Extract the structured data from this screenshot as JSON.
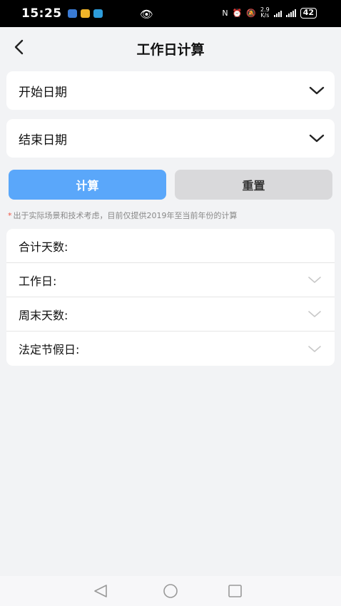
{
  "status_bar": {
    "time": "15:25",
    "network_speed": "2.9",
    "network_unit": "K/s",
    "battery": "42"
  },
  "header": {
    "title": "工作日计算"
  },
  "form": {
    "start_date_label": "开始日期",
    "end_date_label": "结束日期"
  },
  "actions": {
    "calculate_label": "计算",
    "reset_label": "重置"
  },
  "note": {
    "marker": "*",
    "text": "出于实际场景和技术考虑，目前仅提供2019年至当前年份的计算"
  },
  "results": {
    "total_days_label": "合计天数:",
    "workdays_label": "工作日:",
    "weekend_days_label": "周末天数:",
    "holidays_label": "法定节假日:"
  },
  "colors": {
    "accent": "#5aa7fa",
    "reset_bg": "#d9d9db",
    "background": "#f2f3f5"
  }
}
